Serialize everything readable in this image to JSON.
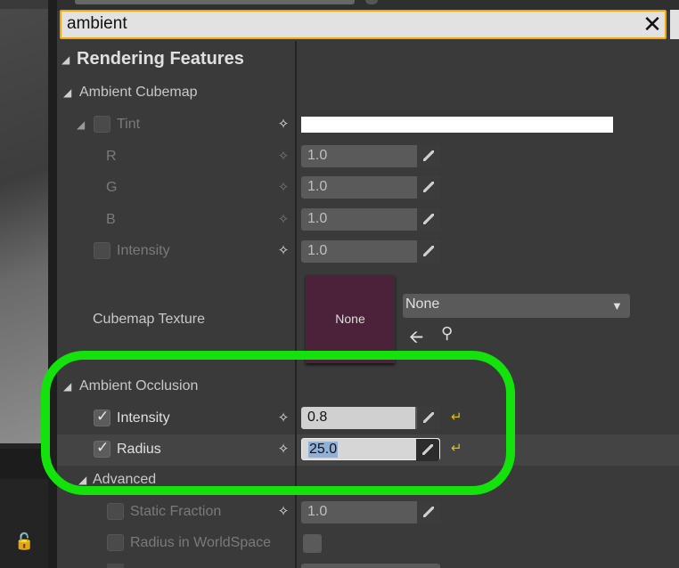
{
  "search": {
    "value": "ambient",
    "clear_icon": "close-icon"
  },
  "sections": {
    "rendering_features": "Rendering Features",
    "ambient_cubemap": "Ambient Cubemap",
    "ambient_occlusion": "Ambient Occlusion",
    "advanced": "Advanced"
  },
  "cubemap": {
    "tint_label": "Tint",
    "r_label": "R",
    "r_value": "1.0",
    "g_label": "G",
    "g_value": "1.0",
    "b_label": "B",
    "b_value": "1.0",
    "intensity_label": "Intensity",
    "intensity_value": "1.0",
    "texture_label": "Cubemap Texture",
    "texture_thumb": "None",
    "texture_dropdown": "None"
  },
  "ao": {
    "intensity_label": "Intensity",
    "intensity_value": "0.8",
    "radius_label": "Radius",
    "radius_value": "25.0"
  },
  "advanced": {
    "static_fraction_label": "Static Fraction",
    "static_fraction_value": "1.0",
    "radius_ws_label": "Radius in WorldSpace"
  },
  "colors": {
    "highlight_ring": "#14e20c",
    "search_border": "#f0a80c",
    "undo": "#e0c000"
  }
}
